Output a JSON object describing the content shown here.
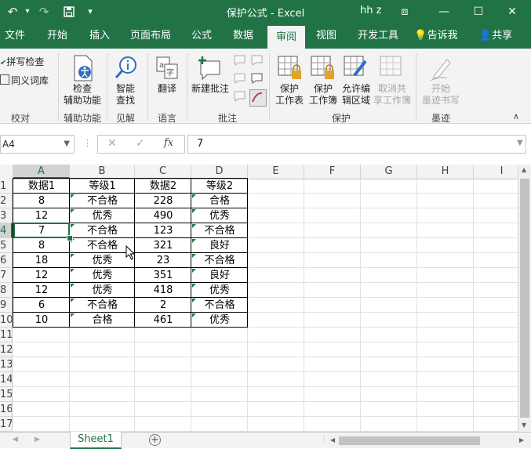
{
  "window": {
    "title": "保护公式  -  Excel",
    "user": "hh z",
    "colors": {
      "accent": "#217346",
      "table_border": "#000000",
      "comment_marker": "#1e7b3d"
    }
  },
  "quick_access": {
    "undo": "↶",
    "redo": "↷",
    "save": "💾",
    "customize": "▾"
  },
  "window_controls": {
    "ribbon_options": "⧈",
    "minimize": "—",
    "restore": "☐",
    "close": "✕"
  },
  "tabs": [
    {
      "label": "文件"
    },
    {
      "label": "开始"
    },
    {
      "label": "插入"
    },
    {
      "label": "页面布局"
    },
    {
      "label": "公式"
    },
    {
      "label": "数据"
    },
    {
      "label": "审阅"
    },
    {
      "label": "视图"
    },
    {
      "label": "开发工具"
    }
  ],
  "active_tab": "审阅",
  "tell_me": "告诉我",
  "share": "共享",
  "ribbon": {
    "proofing": {
      "spell_check": "拼写检查",
      "thesaurus": "同义词库",
      "group": "校对"
    },
    "accessibility": {
      "check_line1": "检查",
      "check_line2": "辅助功能",
      "group": "辅助功能"
    },
    "insights": {
      "smart_line1": "智能",
      "smart_line2": "查找",
      "group": "见解"
    },
    "language": {
      "translate": "翻译",
      "group": "语言"
    },
    "comments": {
      "new_comment": "新建批注",
      "group": "批注"
    },
    "protect": {
      "protect_sheet_line1": "保护",
      "protect_sheet_line2": "工作表",
      "protect_book_line1": "保护",
      "protect_book_line2": "工作簿",
      "allow_edit_line1": "允许编",
      "allow_edit_line2": "辑区域",
      "unshare_line1": "取消共",
      "unshare_line2": "享工作簿",
      "group": "保护"
    },
    "ink": {
      "start_line1": "开始",
      "start_line2": "墨迹书写",
      "group": "墨迹"
    }
  },
  "formula_bar": {
    "name_box": "A4",
    "cancel": "✕",
    "enter": "✓",
    "fx": "fx",
    "value": "7"
  },
  "columns": [
    "A",
    "B",
    "C",
    "D",
    "E",
    "F",
    "G",
    "H",
    "I"
  ],
  "rows": [
    "1",
    "2",
    "3",
    "4",
    "5",
    "6",
    "7",
    "8",
    "9",
    "10",
    "11",
    "12",
    "13",
    "14",
    "15",
    "16",
    "17"
  ],
  "table": {
    "headers": [
      "数据1",
      "等级1",
      "数据2",
      "等级2"
    ],
    "rows": [
      [
        "8",
        "不合格",
        "228",
        "合格"
      ],
      [
        "12",
        "优秀",
        "490",
        "优秀"
      ],
      [
        "7",
        "不合格",
        "123",
        "不合格"
      ],
      [
        "8",
        "不合格",
        "321",
        "良好"
      ],
      [
        "18",
        "优秀",
        "23",
        "不合格"
      ],
      [
        "12",
        "优秀",
        "351",
        "良好"
      ],
      [
        "12",
        "优秀",
        "418",
        "优秀"
      ],
      [
        "6",
        "不合格",
        "2",
        "不合格"
      ],
      [
        "10",
        "合格",
        "461",
        "优秀"
      ]
    ]
  },
  "active_cell": "A4",
  "sheet_tabs": [
    {
      "label": "Sheet1"
    }
  ],
  "add_sheet": "+",
  "nav": {
    "prev": "◀",
    "next": "▶"
  },
  "scroll_arrows": {
    "up": "▲",
    "down": "▼",
    "left": "◀",
    "right": "▶"
  }
}
